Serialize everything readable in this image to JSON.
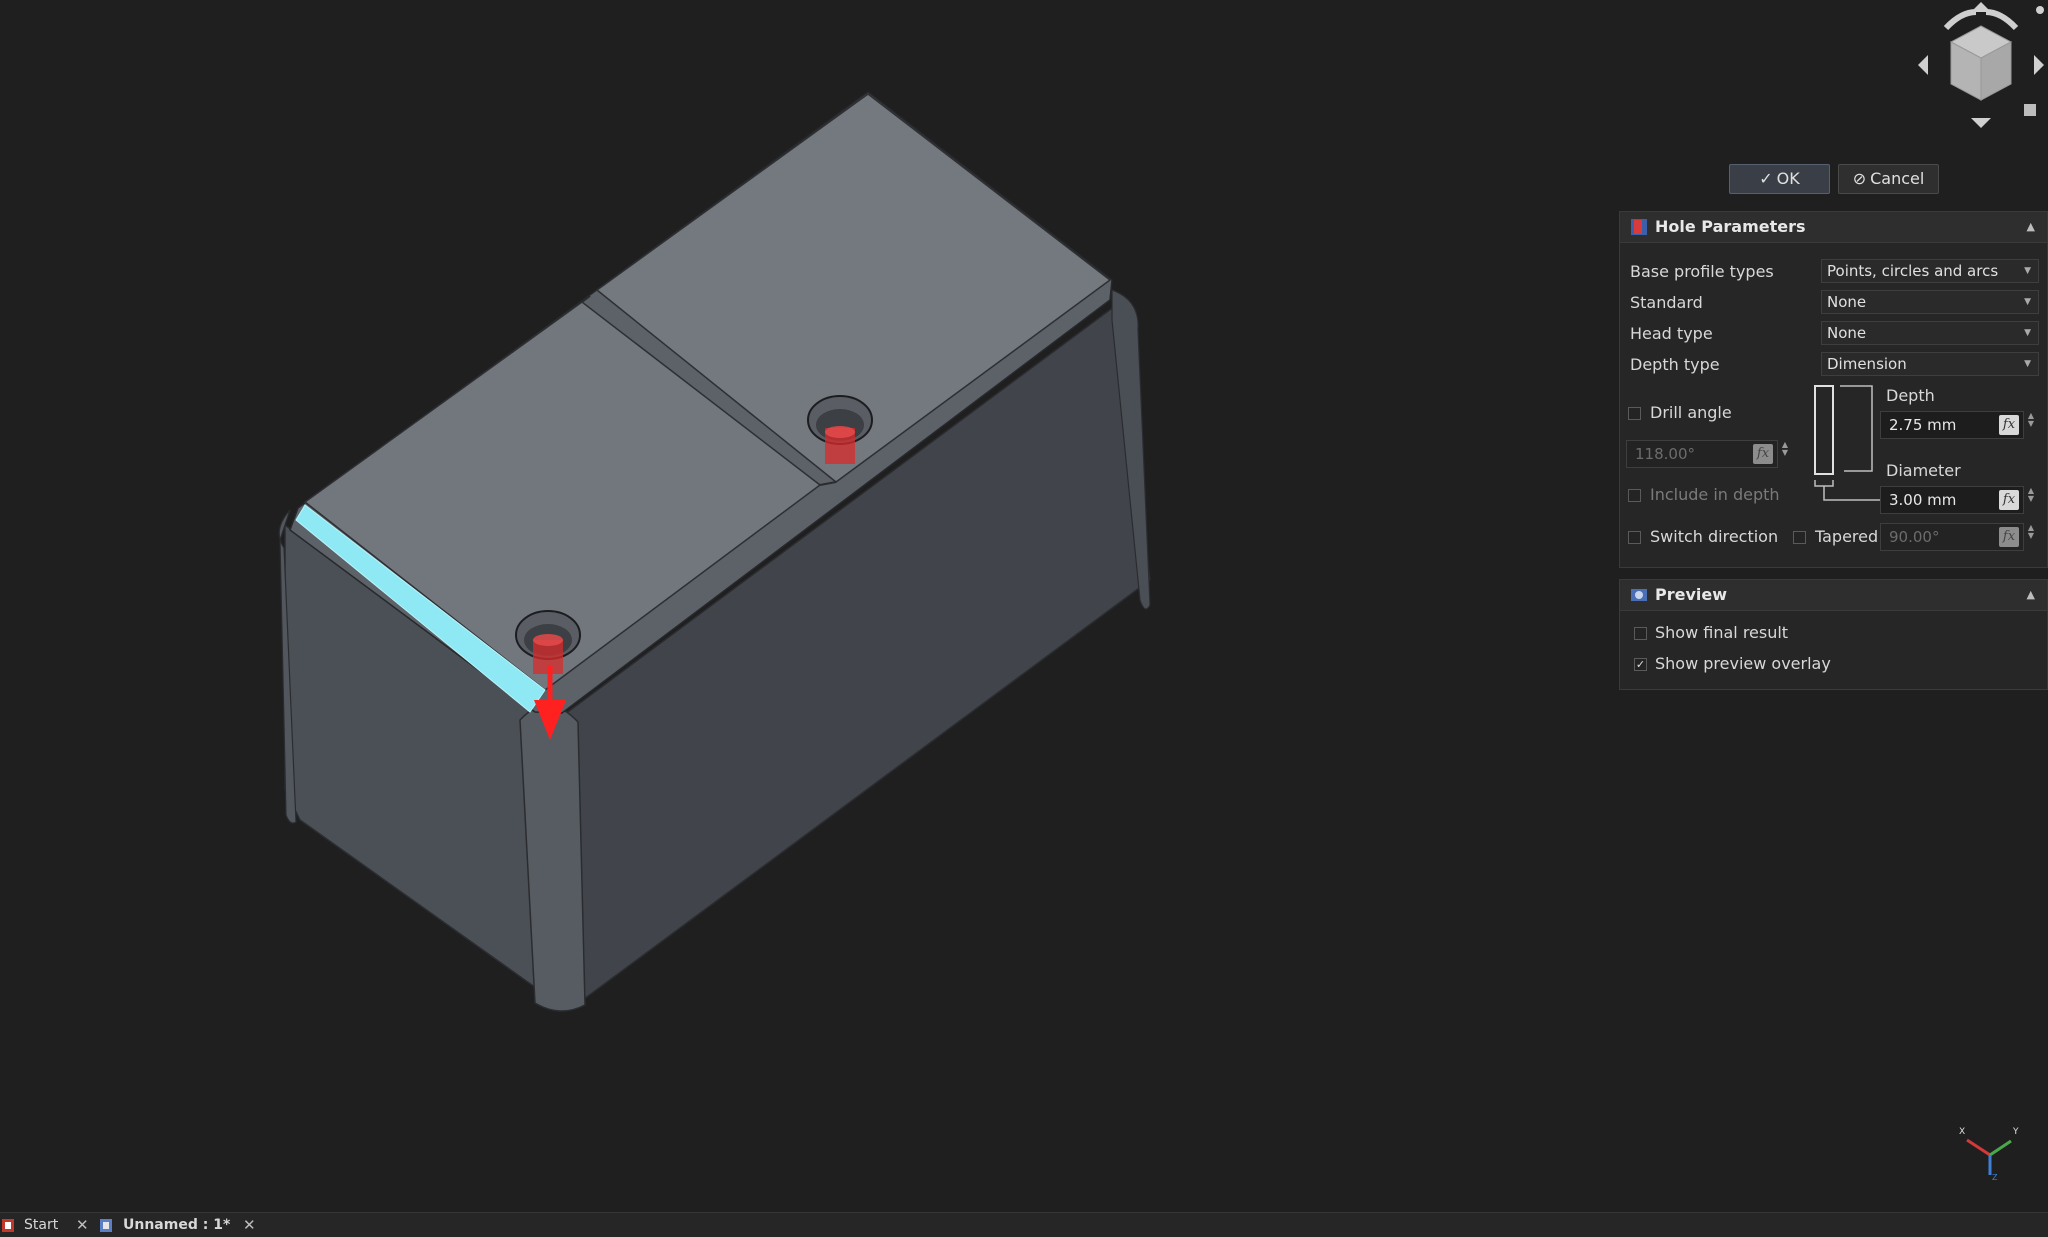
{
  "dialog": {
    "ok_label": "OK",
    "cancel_label": "Cancel"
  },
  "hole_panel": {
    "title": "Hole Parameters",
    "rows": {
      "base_profile_label": "Base profile types",
      "base_profile_value": "Points, circles and arcs",
      "standard_label": "Standard",
      "standard_value": "None",
      "head_type_label": "Head type",
      "head_type_value": "None",
      "depth_type_label": "Depth type",
      "depth_type_value": "Dimension"
    },
    "drill_angle_label": "Drill angle",
    "drill_angle_value": "118.00°",
    "include_in_depth_label": "Include in depth",
    "depth_label": "Depth",
    "depth_value": "2.75 mm",
    "diameter_label": "Diameter",
    "diameter_value": "3.00 mm",
    "switch_direction_label": "Switch direction",
    "tapered_label": "Tapered",
    "tapered_value": "90.00°",
    "fx_label": "fx"
  },
  "preview_panel": {
    "title": "Preview",
    "show_final_label": "Show final result",
    "show_final_checked": false,
    "show_overlay_label": "Show preview overlay",
    "show_overlay_checked": true
  },
  "tabs": [
    {
      "label": "Start"
    },
    {
      "label": "Unnamed : 1*"
    }
  ],
  "axis": {
    "x": "X",
    "y": "Y",
    "z": "Z"
  },
  "colors": {
    "background": "#1f1f1f",
    "model_top": "#70757c",
    "model_side_left": "#4b5057",
    "model_side_right": "#41454b",
    "highlight_edge": "#8fe9f4",
    "hole_preview": "#d92b2b"
  }
}
